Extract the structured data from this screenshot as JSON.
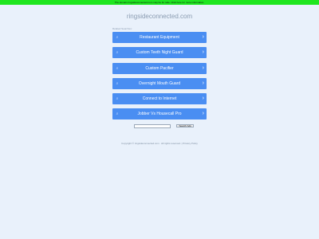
{
  "banner": "The domain ringsideconnected.com may be for sale. Click here for more information.",
  "domain": "ringsideconnected.com",
  "related_label": "Related Searches:",
  "items": [
    {
      "label": "Restaurant Equipment"
    },
    {
      "label": "Custom Teeth Night Guard"
    },
    {
      "label": "Custom Pacifier"
    },
    {
      "label": "Overnight Mouth Guard"
    },
    {
      "label": "Connect to Internet"
    },
    {
      "label": "Jobber Vs Housecall Pro"
    }
  ],
  "search": {
    "placeholder": "",
    "button": "Search Ads"
  },
  "footer": "Copyright © ringsideconnected.com . All rights reserved.  |  Privacy Policy"
}
